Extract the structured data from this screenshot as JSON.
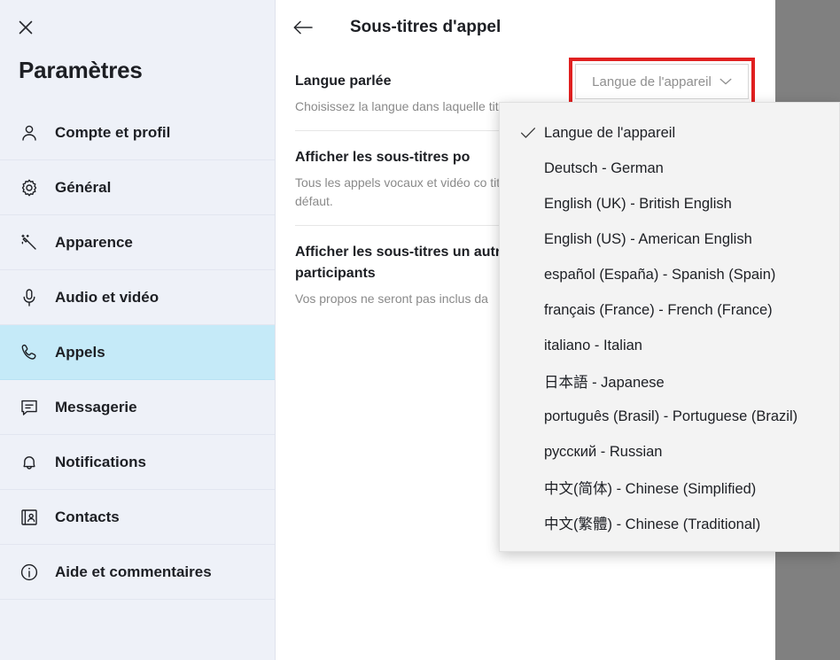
{
  "window": {
    "background_outside": "#808080"
  },
  "sidebar": {
    "close_icon": "close-icon",
    "title": "Paramètres",
    "selected_index": 5,
    "highlight_color": "#c5eaf8",
    "items": [
      {
        "label": "Compte et profil",
        "icon": "person-icon"
      },
      {
        "label": "Général",
        "icon": "gear-icon"
      },
      {
        "label": "Apparence",
        "icon": "magic-wand-icon"
      },
      {
        "label": "Audio et vidéo",
        "icon": "microphone-icon"
      },
      {
        "label": "Appels",
        "icon": "phone-icon"
      },
      {
        "label": "Messagerie",
        "icon": "chat-icon"
      },
      {
        "label": "Notifications",
        "icon": "bell-icon"
      },
      {
        "label": "Contacts",
        "icon": "contact-card-icon"
      },
      {
        "label": "Aide et commentaires",
        "icon": "info-icon"
      }
    ]
  },
  "main": {
    "back_icon": "back-arrow-icon",
    "title": "Sous-titres d'appel",
    "sections": [
      {
        "heading": "Langue parlée",
        "description": "Choisissez la langue dans laquelle titres"
      },
      {
        "heading": "Afficher les sous-titres po",
        "description": "Tous les appels vocaux et vidéo co titres activés par défaut."
      },
      {
        "heading": "Afficher les sous-titres un autres participants",
        "description": "Vos propos ne seront pas inclus da"
      }
    ],
    "language_select": {
      "value": "Langue de l'appareil",
      "chevron": "chevron-down-icon",
      "highlight_color": "#e02020"
    }
  },
  "dropdown": {
    "checked_index": 0,
    "check_icon": "check-icon",
    "options": [
      "Langue de l'appareil",
      "Deutsch - German",
      "English (UK) - British English",
      "English (US) - American English",
      "español (España) - Spanish (Spain)",
      "français (France) - French (France)",
      "italiano - Italian",
      "日本語 - Japanese",
      "português (Brasil) - Portuguese (Brazil)",
      "русский - Russian",
      "中文(简体) - Chinese (Simplified)",
      "中文(繁體) - Chinese (Traditional)"
    ]
  }
}
